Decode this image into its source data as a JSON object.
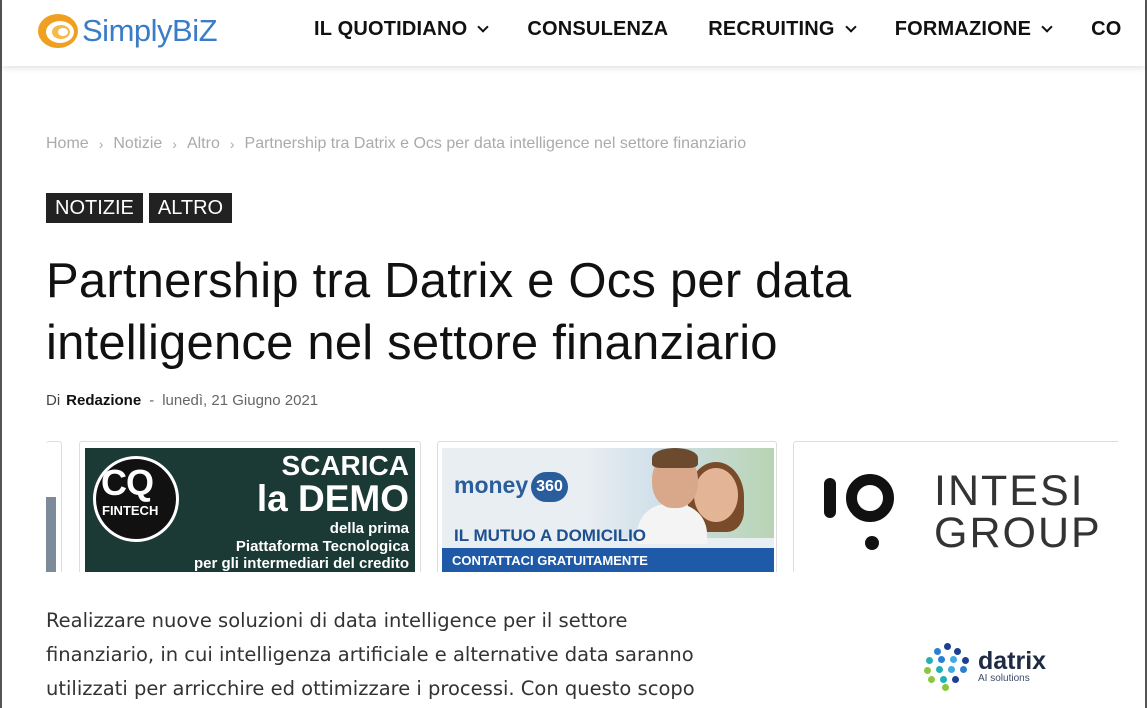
{
  "header": {
    "logo_text": "SimplyBiZ",
    "nav": [
      {
        "label": "IL QUOTIDIANO",
        "has_dropdown": true
      },
      {
        "label": "CONSULENZA",
        "has_dropdown": false
      },
      {
        "label": "RECRUITING",
        "has_dropdown": true
      },
      {
        "label": "FORMAZIONE",
        "has_dropdown": true
      },
      {
        "label": "CO",
        "has_dropdown": false
      }
    ]
  },
  "breadcrumb": {
    "items": [
      "Home",
      "Notizie",
      "Altro",
      "Partnership tra Datrix e Ocs per data intelligence nel settore finanziario"
    ],
    "separator": "›"
  },
  "categories": [
    "NOTIZIE",
    "ALTRO"
  ],
  "article": {
    "title": "Partnership tra Datrix e Ocs per data intelligence nel settore finanziario",
    "by_prefix": "Di",
    "author": "Redazione",
    "dash": "-",
    "date": "lunedì, 21 Giugno 2021",
    "body_lines": [
      "Realizzare nuove soluzioni di data intelligence per il settore",
      "finanziario, in cui intelligenza artificiale e alternative data saranno",
      "utilizzati per arricchire ed ottimizzare i processi. Con questo scopo"
    ]
  },
  "ads": {
    "cq": {
      "logo": "CQ",
      "logo_sub": "FINTECH",
      "line1": "SCARICA",
      "line2": "la DEMO",
      "line3": "della prima",
      "line4": "Piattaforma Tecnologica",
      "line5": "per gli intermediari del credito"
    },
    "money": {
      "brand": "money",
      "brand_badge": "360",
      "headline": "IL MUTUO A DOMICILIO",
      "cta": "CONTATTACI GRATUITAMENTE"
    },
    "intesi": {
      "line1": "INTESI",
      "line2": "GROUP"
    }
  },
  "datrix_logo": {
    "name": "datrix",
    "tagline": "AI solutions"
  },
  "colors": {
    "logo_blue": "#3a7cc7",
    "logo_orange": "#f0a020",
    "badge_bg": "#222222",
    "cq_bg": "#1c3a35",
    "money_blue": "#1e5aa8"
  }
}
